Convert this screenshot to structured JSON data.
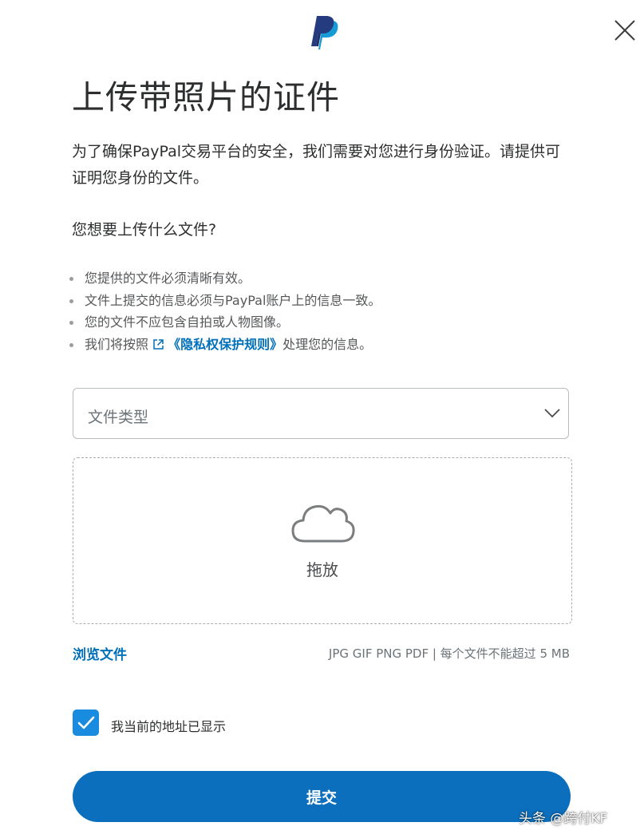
{
  "title": "上传带照片的证件",
  "intro": "为了确保PayPal交易平台的安全，我们需要对您进行身份验证。请提供可证明您身份的文件。",
  "question": "您想要上传什么文件?",
  "rules": [
    "您提供的文件必须清晰有效。",
    "文件上提交的信息必须与PayPal账户上的信息一致。",
    "您的文件不应包含自拍或人物图像。"
  ],
  "policy_line": {
    "prefix": "我们将按照",
    "link": "《隐私权保护规则》",
    "suffix": "处理您的信息。"
  },
  "file_type_select": {
    "placeholder": "文件类型"
  },
  "dropzone": {
    "label": "拖放"
  },
  "browse_link": "浏览文件",
  "formats_note": "JPG GIF PNG PDF | 每个文件不能超过 5 MB",
  "address_checkbox": {
    "checked": true,
    "label": "我当前的地址已显示"
  },
  "submit_button": "提交",
  "watermark": "头条 @跨付KF",
  "colors": {
    "brand_blue": "#0070ba",
    "button_blue": "#0b6fbd",
    "checkbox_blue": "#1a8cdf",
    "logo_dark": "#253b80",
    "logo_light": "#179bd7"
  },
  "icons": {
    "logo": "paypal-logo",
    "close": "close-icon",
    "dropdown": "chevron-down-icon",
    "upload": "cloud-icon",
    "external_link": "external-link-icon",
    "checkbox": "checkmark-icon"
  }
}
